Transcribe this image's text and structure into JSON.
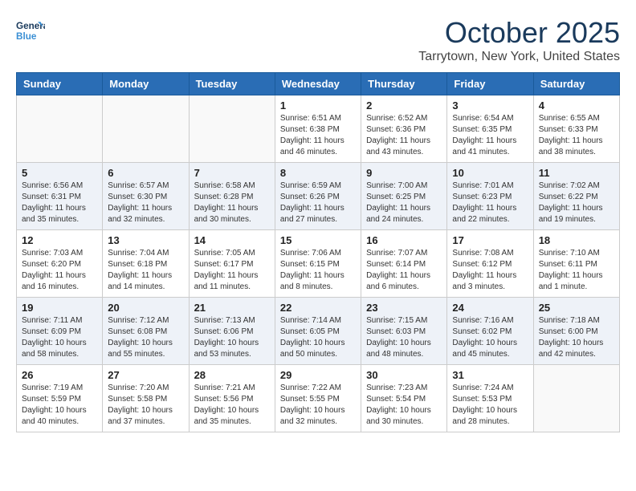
{
  "header": {
    "logo_line1": "General",
    "logo_line2": "Blue",
    "month": "October 2025",
    "location": "Tarrytown, New York, United States"
  },
  "weekdays": [
    "Sunday",
    "Monday",
    "Tuesday",
    "Wednesday",
    "Thursday",
    "Friday",
    "Saturday"
  ],
  "weeks": [
    [
      {
        "day": "",
        "info": ""
      },
      {
        "day": "",
        "info": ""
      },
      {
        "day": "",
        "info": ""
      },
      {
        "day": "1",
        "info": "Sunrise: 6:51 AM\nSunset: 6:38 PM\nDaylight: 11 hours\nand 46 minutes."
      },
      {
        "day": "2",
        "info": "Sunrise: 6:52 AM\nSunset: 6:36 PM\nDaylight: 11 hours\nand 43 minutes."
      },
      {
        "day": "3",
        "info": "Sunrise: 6:54 AM\nSunset: 6:35 PM\nDaylight: 11 hours\nand 41 minutes."
      },
      {
        "day": "4",
        "info": "Sunrise: 6:55 AM\nSunset: 6:33 PM\nDaylight: 11 hours\nand 38 minutes."
      }
    ],
    [
      {
        "day": "5",
        "info": "Sunrise: 6:56 AM\nSunset: 6:31 PM\nDaylight: 11 hours\nand 35 minutes."
      },
      {
        "day": "6",
        "info": "Sunrise: 6:57 AM\nSunset: 6:30 PM\nDaylight: 11 hours\nand 32 minutes."
      },
      {
        "day": "7",
        "info": "Sunrise: 6:58 AM\nSunset: 6:28 PM\nDaylight: 11 hours\nand 30 minutes."
      },
      {
        "day": "8",
        "info": "Sunrise: 6:59 AM\nSunset: 6:26 PM\nDaylight: 11 hours\nand 27 minutes."
      },
      {
        "day": "9",
        "info": "Sunrise: 7:00 AM\nSunset: 6:25 PM\nDaylight: 11 hours\nand 24 minutes."
      },
      {
        "day": "10",
        "info": "Sunrise: 7:01 AM\nSunset: 6:23 PM\nDaylight: 11 hours\nand 22 minutes."
      },
      {
        "day": "11",
        "info": "Sunrise: 7:02 AM\nSunset: 6:22 PM\nDaylight: 11 hours\nand 19 minutes."
      }
    ],
    [
      {
        "day": "12",
        "info": "Sunrise: 7:03 AM\nSunset: 6:20 PM\nDaylight: 11 hours\nand 16 minutes."
      },
      {
        "day": "13",
        "info": "Sunrise: 7:04 AM\nSunset: 6:18 PM\nDaylight: 11 hours\nand 14 minutes."
      },
      {
        "day": "14",
        "info": "Sunrise: 7:05 AM\nSunset: 6:17 PM\nDaylight: 11 hours\nand 11 minutes."
      },
      {
        "day": "15",
        "info": "Sunrise: 7:06 AM\nSunset: 6:15 PM\nDaylight: 11 hours\nand 8 minutes."
      },
      {
        "day": "16",
        "info": "Sunrise: 7:07 AM\nSunset: 6:14 PM\nDaylight: 11 hours\nand 6 minutes."
      },
      {
        "day": "17",
        "info": "Sunrise: 7:08 AM\nSunset: 6:12 PM\nDaylight: 11 hours\nand 3 minutes."
      },
      {
        "day": "18",
        "info": "Sunrise: 7:10 AM\nSunset: 6:11 PM\nDaylight: 11 hours\nand 1 minute."
      }
    ],
    [
      {
        "day": "19",
        "info": "Sunrise: 7:11 AM\nSunset: 6:09 PM\nDaylight: 10 hours\nand 58 minutes."
      },
      {
        "day": "20",
        "info": "Sunrise: 7:12 AM\nSunset: 6:08 PM\nDaylight: 10 hours\nand 55 minutes."
      },
      {
        "day": "21",
        "info": "Sunrise: 7:13 AM\nSunset: 6:06 PM\nDaylight: 10 hours\nand 53 minutes."
      },
      {
        "day": "22",
        "info": "Sunrise: 7:14 AM\nSunset: 6:05 PM\nDaylight: 10 hours\nand 50 minutes."
      },
      {
        "day": "23",
        "info": "Sunrise: 7:15 AM\nSunset: 6:03 PM\nDaylight: 10 hours\nand 48 minutes."
      },
      {
        "day": "24",
        "info": "Sunrise: 7:16 AM\nSunset: 6:02 PM\nDaylight: 10 hours\nand 45 minutes."
      },
      {
        "day": "25",
        "info": "Sunrise: 7:18 AM\nSunset: 6:00 PM\nDaylight: 10 hours\nand 42 minutes."
      }
    ],
    [
      {
        "day": "26",
        "info": "Sunrise: 7:19 AM\nSunset: 5:59 PM\nDaylight: 10 hours\nand 40 minutes."
      },
      {
        "day": "27",
        "info": "Sunrise: 7:20 AM\nSunset: 5:58 PM\nDaylight: 10 hours\nand 37 minutes."
      },
      {
        "day": "28",
        "info": "Sunrise: 7:21 AM\nSunset: 5:56 PM\nDaylight: 10 hours\nand 35 minutes."
      },
      {
        "day": "29",
        "info": "Sunrise: 7:22 AM\nSunset: 5:55 PM\nDaylight: 10 hours\nand 32 minutes."
      },
      {
        "day": "30",
        "info": "Sunrise: 7:23 AM\nSunset: 5:54 PM\nDaylight: 10 hours\nand 30 minutes."
      },
      {
        "day": "31",
        "info": "Sunrise: 7:24 AM\nSunset: 5:53 PM\nDaylight: 10 hours\nand 28 minutes."
      },
      {
        "day": "",
        "info": ""
      }
    ]
  ]
}
